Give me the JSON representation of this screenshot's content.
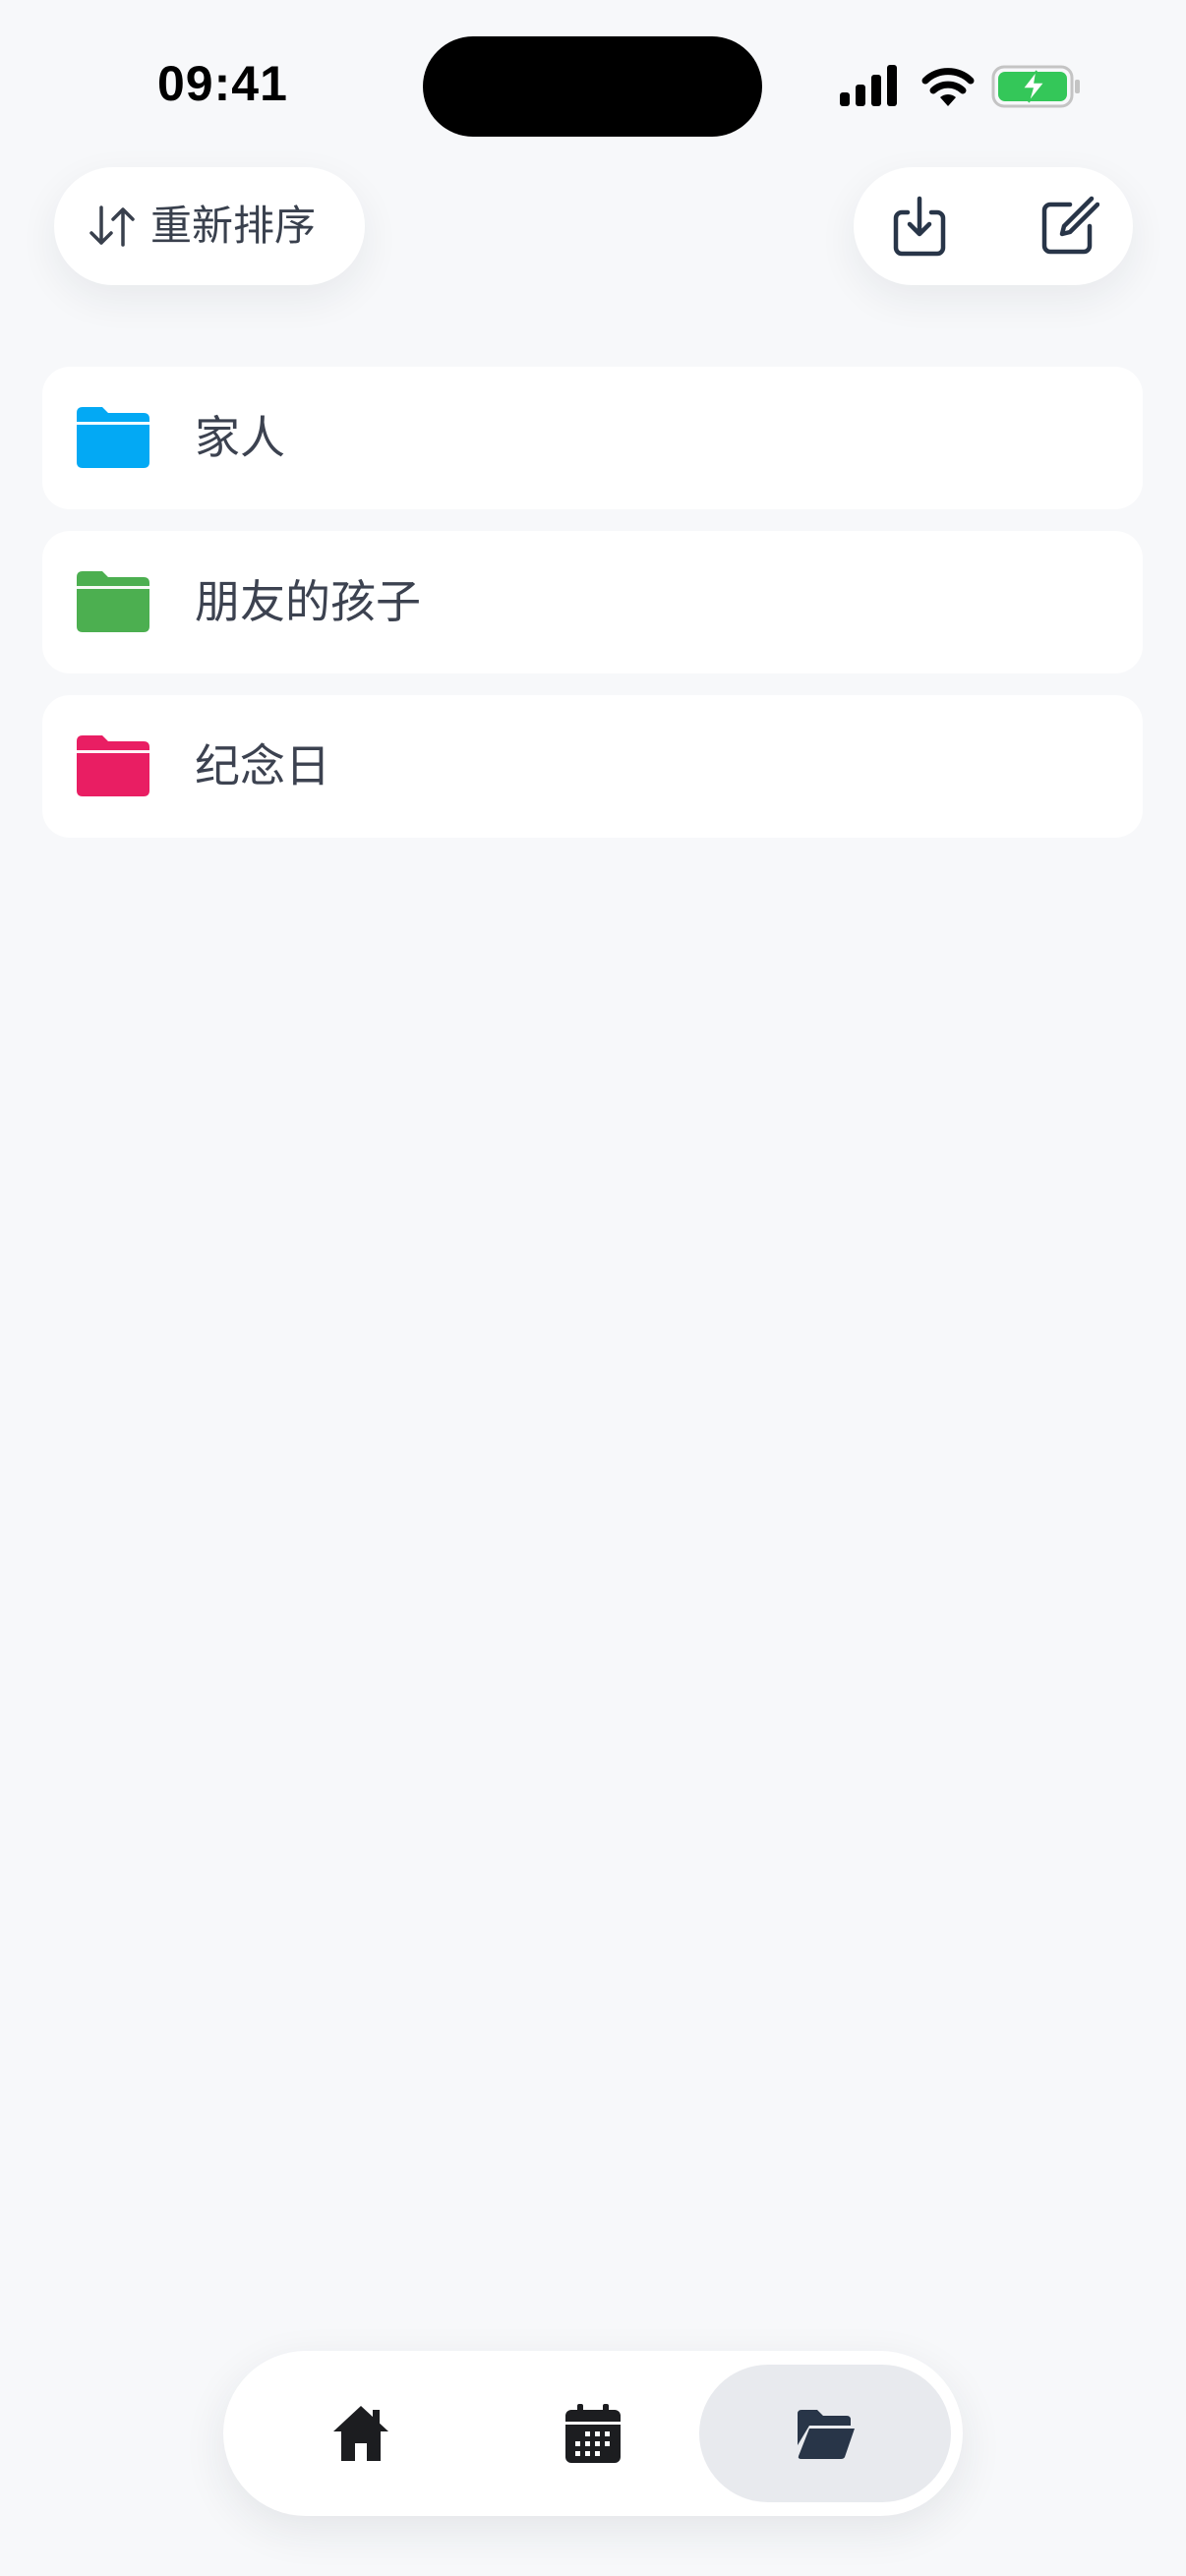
{
  "status_bar": {
    "time": "09:41",
    "icons": [
      "cellular-signal-icon",
      "wifi-icon",
      "battery-charging-icon"
    ],
    "battery_color": "#34c759"
  },
  "toolbar": {
    "reorder_label": "重新排序",
    "reorder_icon": "sort-arrows-icon",
    "import_icon": "import-icon",
    "edit_icon": "compose-icon"
  },
  "folders": [
    {
      "name": "家人",
      "color": "#03a9f4"
    },
    {
      "name": "朋友的孩子",
      "color": "#4caf50"
    },
    {
      "name": "纪念日",
      "color": "#e91e63"
    }
  ],
  "tab_bar": {
    "tabs": [
      {
        "icon": "home-icon",
        "selected": false
      },
      {
        "icon": "calendar-icon",
        "selected": false
      },
      {
        "icon": "folder-open-icon",
        "selected": true
      }
    ]
  },
  "colors": {
    "background": "#f7f8fa",
    "text": "#3c4250",
    "selected_tab_bg": "#e8eaee",
    "selected_tab_icon": "#283548"
  }
}
